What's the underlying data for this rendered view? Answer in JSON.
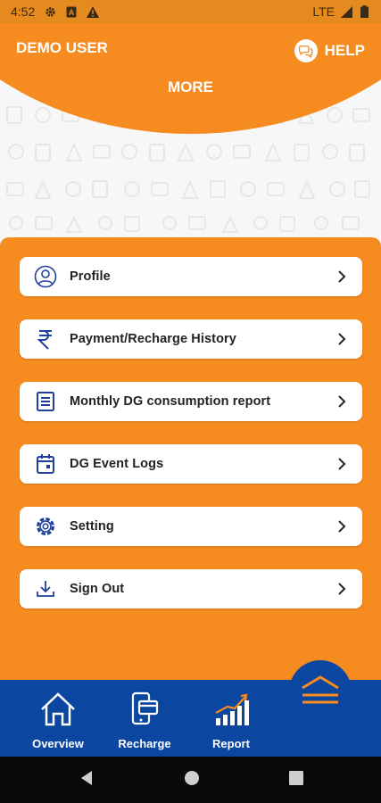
{
  "status_bar": {
    "time": "4:52",
    "network": "LTE",
    "icons": [
      "gear-icon",
      "a-icon",
      "warning-icon",
      "signal-icon",
      "battery-icon"
    ]
  },
  "header": {
    "user_name": "DEMO USER",
    "help_label": "HELP",
    "title": "MORE"
  },
  "menu": {
    "items": [
      {
        "label": "Profile",
        "icon": "profile-icon"
      },
      {
        "label": "Payment/Recharge History",
        "icon": "rupee-icon"
      },
      {
        "label": "Monthly DG consumption report",
        "icon": "report-icon"
      },
      {
        "label": "DG Event Logs",
        "icon": "calendar-icon"
      },
      {
        "label": "Setting",
        "icon": "gear-icon"
      },
      {
        "label": "Sign Out",
        "icon": "sign-out-icon"
      }
    ]
  },
  "bottom_nav": {
    "items": [
      {
        "label": "Overview",
        "icon": "home-icon"
      },
      {
        "label": "Recharge",
        "icon": "recharge-icon"
      },
      {
        "label": "Report",
        "icon": "chart-icon"
      }
    ],
    "fab_icon": "expand-up-icon"
  },
  "colors": {
    "primary_orange": "#f68b1f",
    "nav_blue": "#0b46a1",
    "icon_blue": "#1f3f9c"
  }
}
